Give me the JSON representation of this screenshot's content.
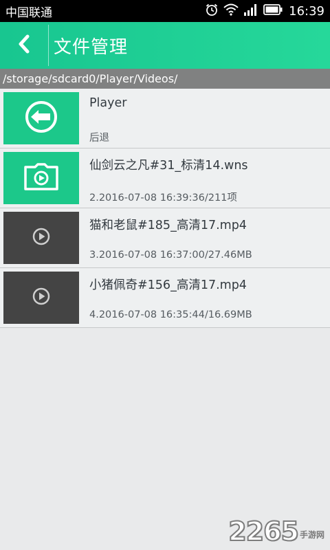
{
  "status_bar": {
    "carrier": "中国联通",
    "time": "16:39",
    "icons": [
      "alarm-icon",
      "wifi-icon",
      "signal-icon",
      "battery-icon"
    ]
  },
  "app_bar": {
    "title": "文件管理",
    "back_icon": "chevron-left-icon",
    "background": "#1ecf94"
  },
  "path": "/storage/sdcard0/Player/Videos/",
  "items": [
    {
      "name": "Player",
      "sub": "后退",
      "icon": "back-arrow-icon",
      "thumb": "green"
    },
    {
      "name": "仙剑云之凡#31_标清14.wns",
      "sub": "2.2016-07-08 16:39:36/211项",
      "icon": "folder-video-icon",
      "thumb": "green"
    },
    {
      "name": "猫和老鼠#185_高清17.mp4",
      "sub": "3.2016-07-08 16:37:00/27.46MB",
      "icon": "play-icon",
      "thumb": "dark"
    },
    {
      "name": "小猪佩奇#156_高清17.mp4",
      "sub": "4.2016-07-08 16:35:44/16.69MB",
      "icon": "play-icon",
      "thumb": "dark"
    }
  ],
  "watermark": {
    "number": "2265",
    "text": "手游网"
  },
  "colors": {
    "accent": "#1cc88a",
    "dark_thumb": "#444444",
    "path_bar": "#808181",
    "list_bg": "#eef0f1"
  }
}
